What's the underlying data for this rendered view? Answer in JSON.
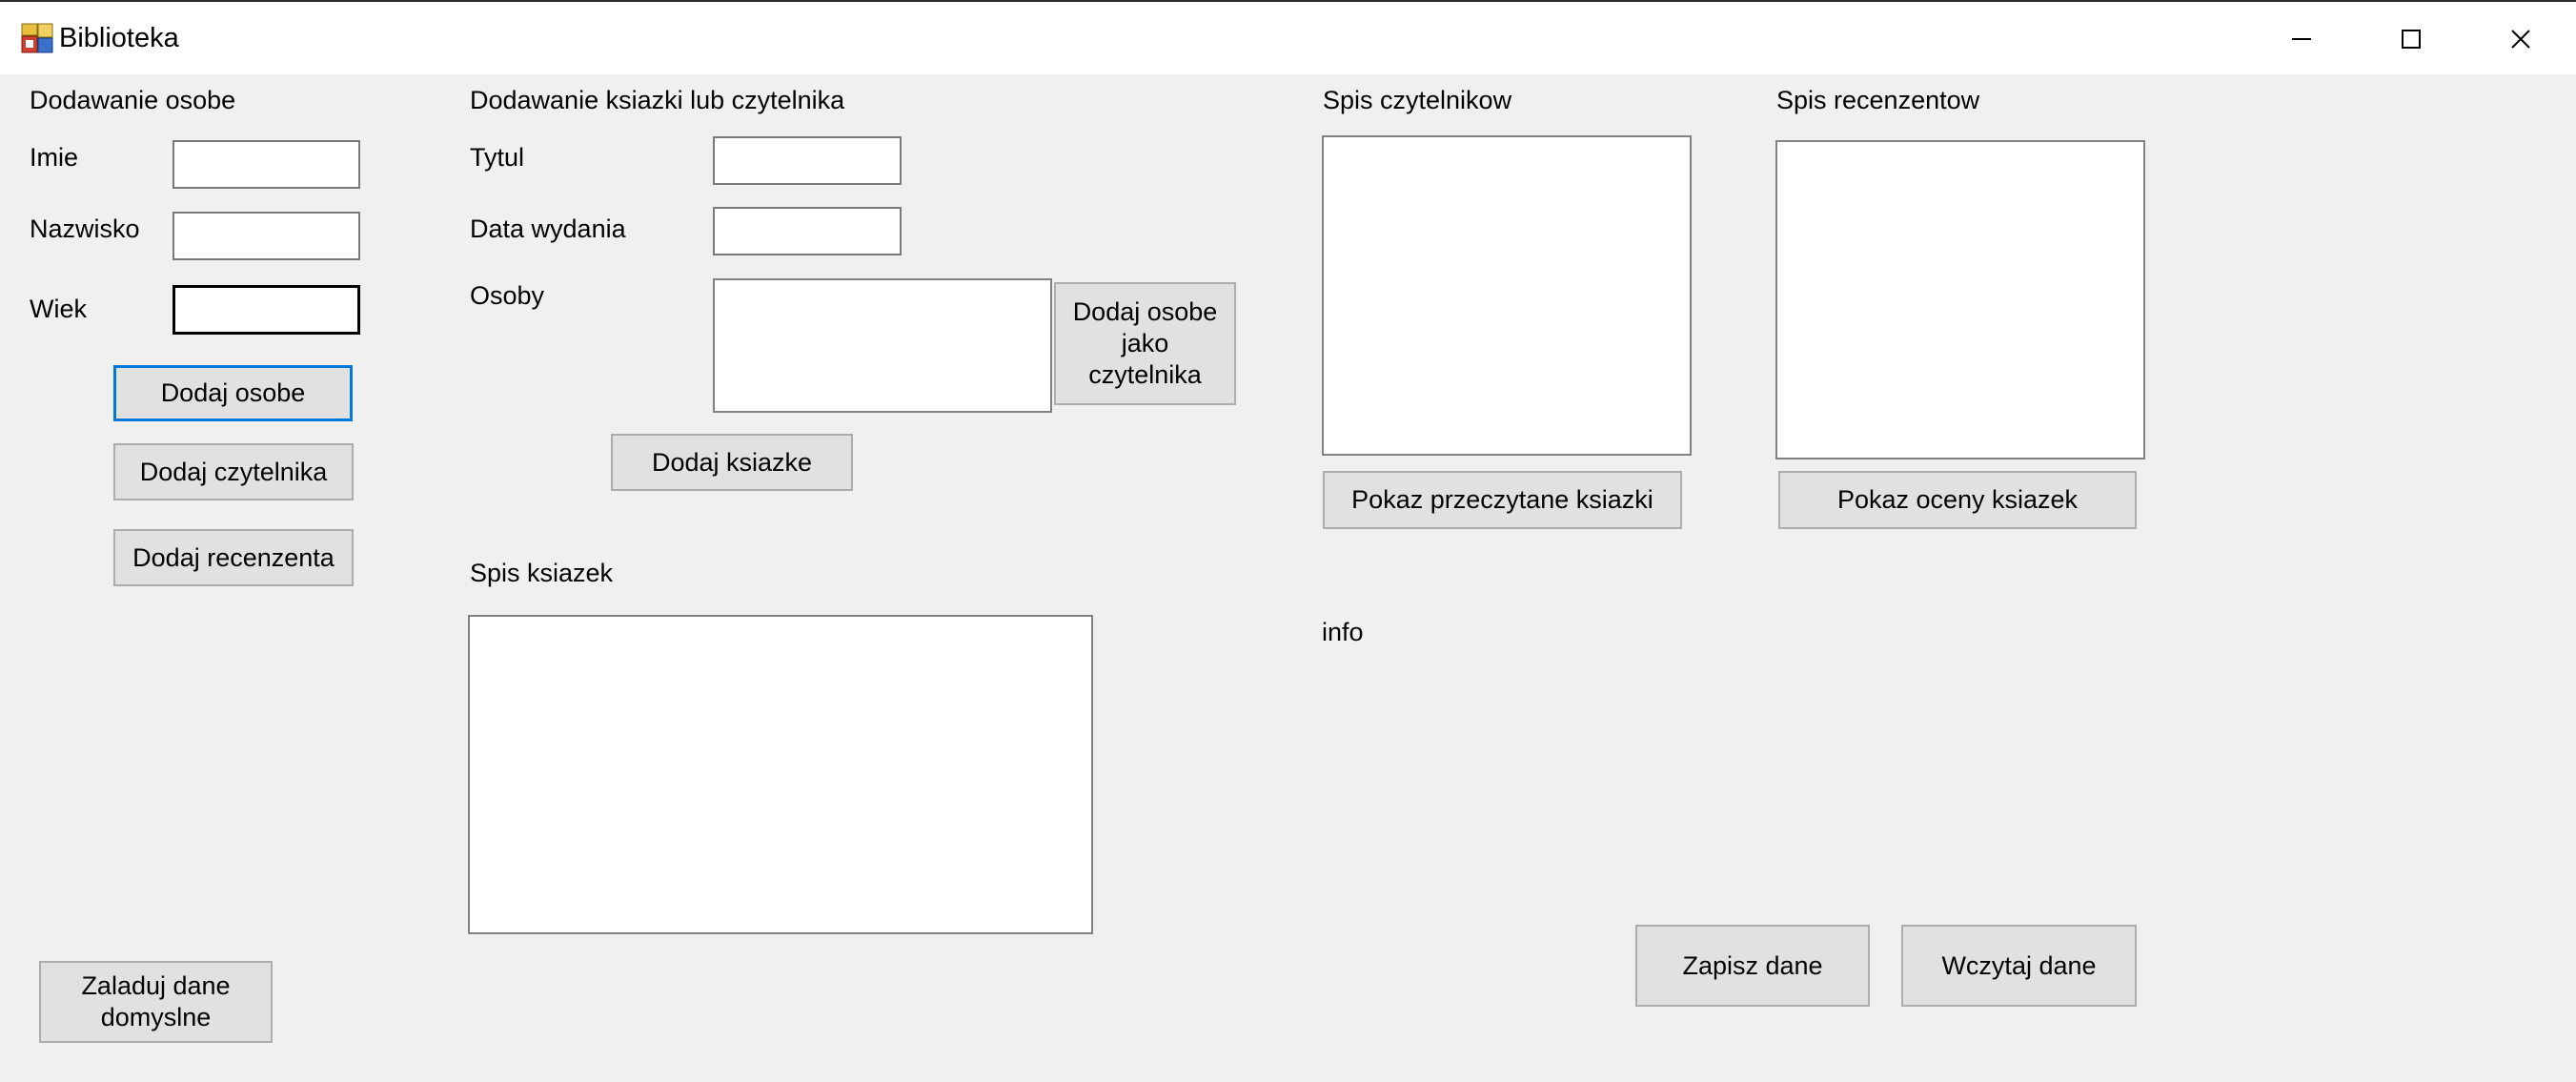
{
  "window": {
    "title": "Biblioteka",
    "icon": "app-window-icon",
    "controls": [
      "minimize-icon",
      "maximize-icon",
      "close-icon"
    ]
  },
  "person_panel": {
    "heading": "Dodawanie osobe",
    "first_name_label": "Imie",
    "first_name_value": "",
    "last_name_label": "Nazwisko",
    "last_name_value": "",
    "age_label": "Wiek",
    "age_value": "",
    "add_person_button": "Dodaj osobe",
    "add_reader_button": "Dodaj czytelnika",
    "add_reviewer_button": "Dodaj recenzenta"
  },
  "book_panel": {
    "heading": "Dodawanie ksiazki lub czytelnika",
    "title_label": "Tytul",
    "title_value": "",
    "date_label": "Data wydania",
    "date_value": "",
    "persons_label": "Osoby",
    "add_person_as_reader_button": "Dodaj osobe jako czytelnika",
    "add_book_button": "Dodaj ksiazke"
  },
  "books_list": {
    "heading": "Spis ksiazek",
    "items": []
  },
  "readers_list": {
    "heading": "Spis czytelnikow",
    "items": [],
    "show_read_books_button": "Pokaz przeczytane ksiazki"
  },
  "reviewers_list": {
    "heading": "Spis recenzentow",
    "items": [],
    "show_book_ratings_button": "Pokaz oceny ksiazek"
  },
  "info": {
    "label": "info"
  },
  "footer": {
    "load_default_button": "Zaladuj dane domyslne",
    "save_button": "Zapisz dane",
    "load_button": "Wczytaj dane"
  },
  "colors": {
    "window_bg": "#f0f0f0",
    "titlebar_bg": "#ffffff",
    "button_bg": "#e1e1e1",
    "button_border": "#adadad",
    "focus_accent": "#0078d7"
  }
}
